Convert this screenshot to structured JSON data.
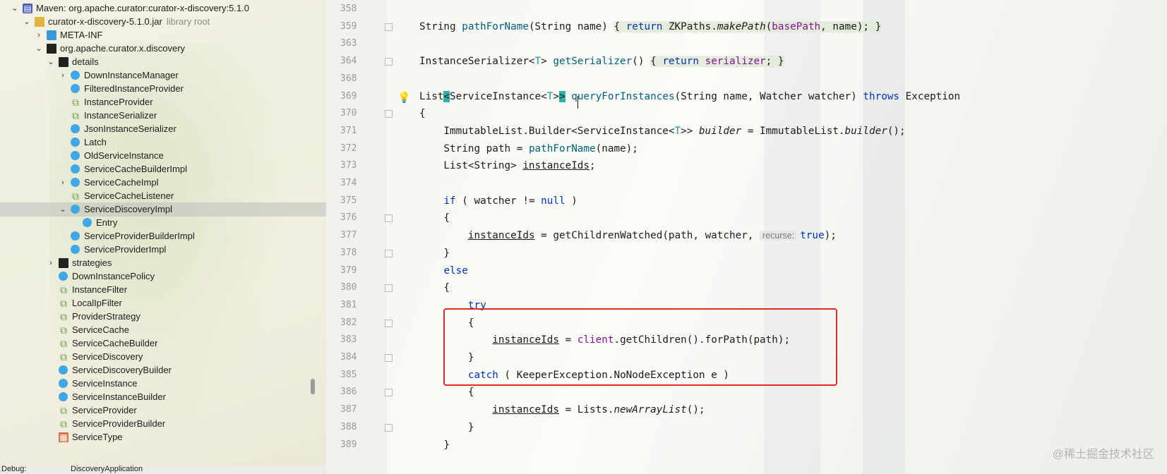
{
  "tree": {
    "items": [
      {
        "label": "Maven: org.apache.curator:curator-x-discovery:5.1.0",
        "icon": "module-icon",
        "arrow": "expanded"
      },
      {
        "label": "curator-x-discovery-5.1.0.jar",
        "extra": "library root",
        "icon": "jar-icon",
        "arrow": "expanded"
      },
      {
        "label": "META-INF",
        "icon": "folder-icon",
        "arrow": "collapsed"
      },
      {
        "label": "org.apache.curator.x.discovery",
        "icon": "package-icon",
        "arrow": "expanded"
      },
      {
        "label": "details",
        "icon": "package-icon",
        "arrow": "expanded"
      },
      {
        "label": "DownInstanceManager",
        "icon": "class-icon",
        "arrow": "collapsed"
      },
      {
        "label": "FilteredInstanceProvider",
        "icon": "class-icon",
        "arrow": ""
      },
      {
        "label": "InstanceProvider",
        "icon": "interface-icon",
        "arrow": ""
      },
      {
        "label": "InstanceSerializer",
        "icon": "interface-icon",
        "arrow": ""
      },
      {
        "label": "JsonInstanceSerializer",
        "icon": "class-icon",
        "arrow": ""
      },
      {
        "label": "Latch",
        "icon": "class-icon",
        "arrow": ""
      },
      {
        "label": "OldServiceInstance",
        "icon": "class-icon",
        "arrow": ""
      },
      {
        "label": "ServiceCacheBuilderImpl",
        "icon": "class-icon",
        "arrow": ""
      },
      {
        "label": "ServiceCacheImpl",
        "icon": "class-icon",
        "arrow": "collapsed"
      },
      {
        "label": "ServiceCacheListener",
        "icon": "interface-icon",
        "arrow": ""
      },
      {
        "label": "ServiceDiscoveryImpl",
        "icon": "class-icon",
        "arrow": "expanded",
        "selected": true
      },
      {
        "label": "Entry",
        "icon": "class-icon",
        "arrow": ""
      },
      {
        "label": "ServiceProviderBuilderImpl",
        "icon": "class-icon",
        "arrow": ""
      },
      {
        "label": "ServiceProviderImpl",
        "icon": "class-icon",
        "arrow": ""
      },
      {
        "label": "strategies",
        "icon": "package-icon",
        "arrow": "collapsed"
      },
      {
        "label": "DownInstancePolicy",
        "icon": "class-icon",
        "arrow": ""
      },
      {
        "label": "InstanceFilter",
        "icon": "interface-icon",
        "arrow": ""
      },
      {
        "label": "LocalIpFilter",
        "icon": "interface-icon",
        "arrow": ""
      },
      {
        "label": "ProviderStrategy",
        "icon": "interface-icon",
        "arrow": ""
      },
      {
        "label": "ServiceCache",
        "icon": "interface-icon",
        "arrow": ""
      },
      {
        "label": "ServiceCacheBuilder",
        "icon": "interface-icon",
        "arrow": ""
      },
      {
        "label": "ServiceDiscovery",
        "icon": "interface-icon",
        "arrow": ""
      },
      {
        "label": "ServiceDiscoveryBuilder",
        "icon": "class-icon",
        "arrow": ""
      },
      {
        "label": "ServiceInstance",
        "icon": "class-icon",
        "arrow": ""
      },
      {
        "label": "ServiceInstanceBuilder",
        "icon": "class-icon",
        "arrow": ""
      },
      {
        "label": "ServiceProvider",
        "icon": "interface-icon",
        "arrow": ""
      },
      {
        "label": "ServiceProviderBuilder",
        "icon": "interface-icon",
        "arrow": ""
      },
      {
        "label": "ServiceType",
        "icon": "enum-icon",
        "arrow": ""
      }
    ],
    "bottom_left": "Debug:",
    "bottom_tab": "DiscoveryApplication"
  },
  "editor": {
    "lines": [
      {
        "num": "358",
        "text": ""
      },
      {
        "num": "359",
        "text": "String pathForName(String name) { return ZKPaths.makePath(basePath, name); }"
      },
      {
        "num": "363",
        "text": ""
      },
      {
        "num": "364",
        "text": "InstanceSerializer<T> getSerializer() { return serializer; }"
      },
      {
        "num": "368",
        "text": ""
      },
      {
        "num": "369",
        "text": "List<ServiceInstance<T>> queryForInstances(String name, Watcher watcher) throws Exception"
      },
      {
        "num": "370",
        "text": "{"
      },
      {
        "num": "371",
        "text": "    ImmutableList.Builder<ServiceInstance<T>> builder = ImmutableList.builder();"
      },
      {
        "num": "372",
        "text": "    String path = pathForName(name);"
      },
      {
        "num": "373",
        "text": "    List<String> instanceIds;"
      },
      {
        "num": "374",
        "text": ""
      },
      {
        "num": "375",
        "text": "    if ( watcher != null )"
      },
      {
        "num": "376",
        "text": "    {"
      },
      {
        "num": "377",
        "text": "        instanceIds = getChildrenWatched(path, watcher, recurse: true);"
      },
      {
        "num": "378",
        "text": "    }"
      },
      {
        "num": "379",
        "text": "    else"
      },
      {
        "num": "380",
        "text": "    {"
      },
      {
        "num": "381",
        "text": "        try"
      },
      {
        "num": "382",
        "text": "        {"
      },
      {
        "num": "383",
        "text": "            instanceIds = client.getChildren().forPath(path);"
      },
      {
        "num": "384",
        "text": "        }"
      },
      {
        "num": "385",
        "text": "        catch ( KeeperException.NoNodeException e )"
      },
      {
        "num": "386",
        "text": "        {"
      },
      {
        "num": "387",
        "text": "            instanceIds = Lists.newArrayList();"
      },
      {
        "num": "388",
        "text": "        }"
      },
      {
        "num": "389",
        "text": "    }"
      }
    ],
    "hint_label": "recurse:",
    "watermark": "@稀土掘金技术社区",
    "highlight_color": "#e02a2a"
  }
}
